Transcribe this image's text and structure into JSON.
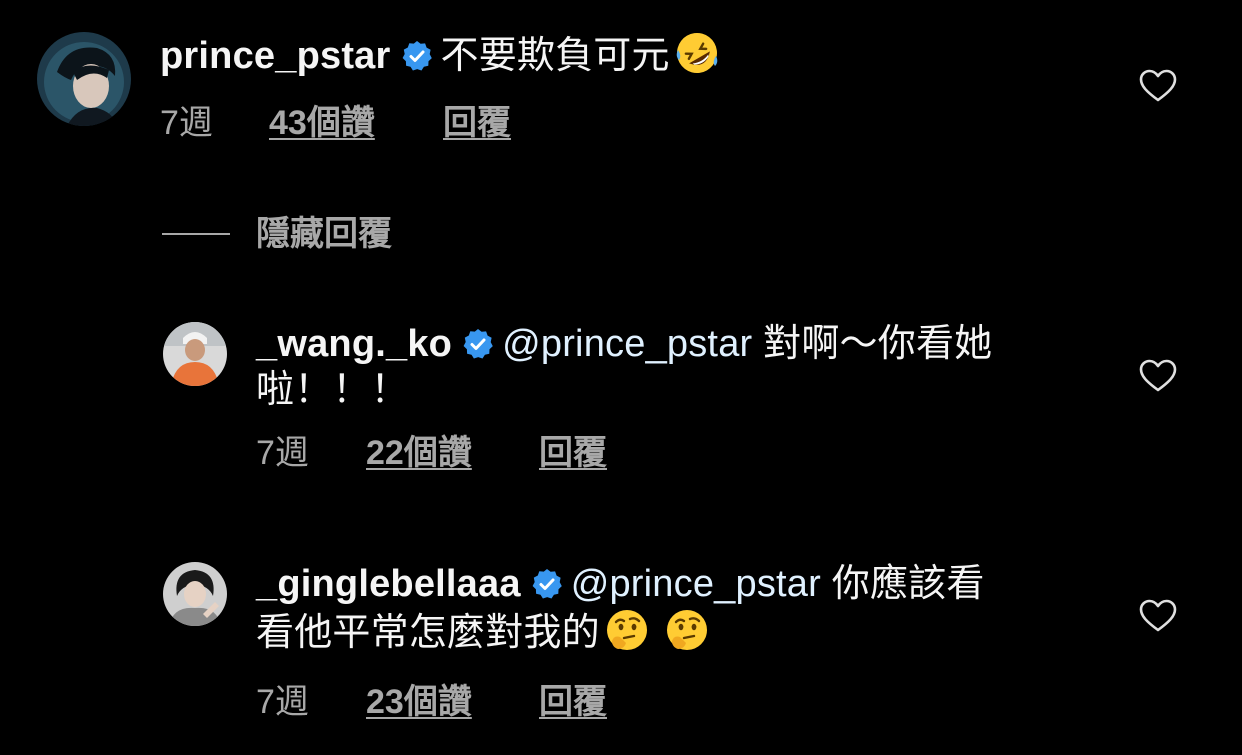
{
  "comments": [
    {
      "username": "prince_pstar",
      "verified": true,
      "mention": "",
      "text": "不要欺負可元",
      "emojis": [
        "rolling-on-floor-laughing"
      ],
      "time": "7週",
      "likes": "43個讚",
      "reply": "回覆"
    },
    {
      "username": "_wang._ko",
      "verified": true,
      "mention": "@prince_pstar",
      "text_line1": "對啊～你看她",
      "text_line2": "啦！！！",
      "time": "7週",
      "likes": "22個讚",
      "reply": "回覆"
    },
    {
      "username": "_ginglebellaaa",
      "verified": true,
      "mention": "@prince_pstar",
      "text_line1": "你應該看",
      "text_line2": "看他平常怎麼對我的",
      "emojis": [
        "thinking-face",
        "thinking-face"
      ],
      "time": "7週",
      "likes": "23個讚",
      "reply": "回覆"
    }
  ],
  "hide_replies_label": "隱藏回覆",
  "colors": {
    "background": "#000000",
    "text": "#f5f5f5",
    "secondary": "#a8a8a8",
    "verified_badge": "#3897f0",
    "mention": "#e0f1ff"
  }
}
